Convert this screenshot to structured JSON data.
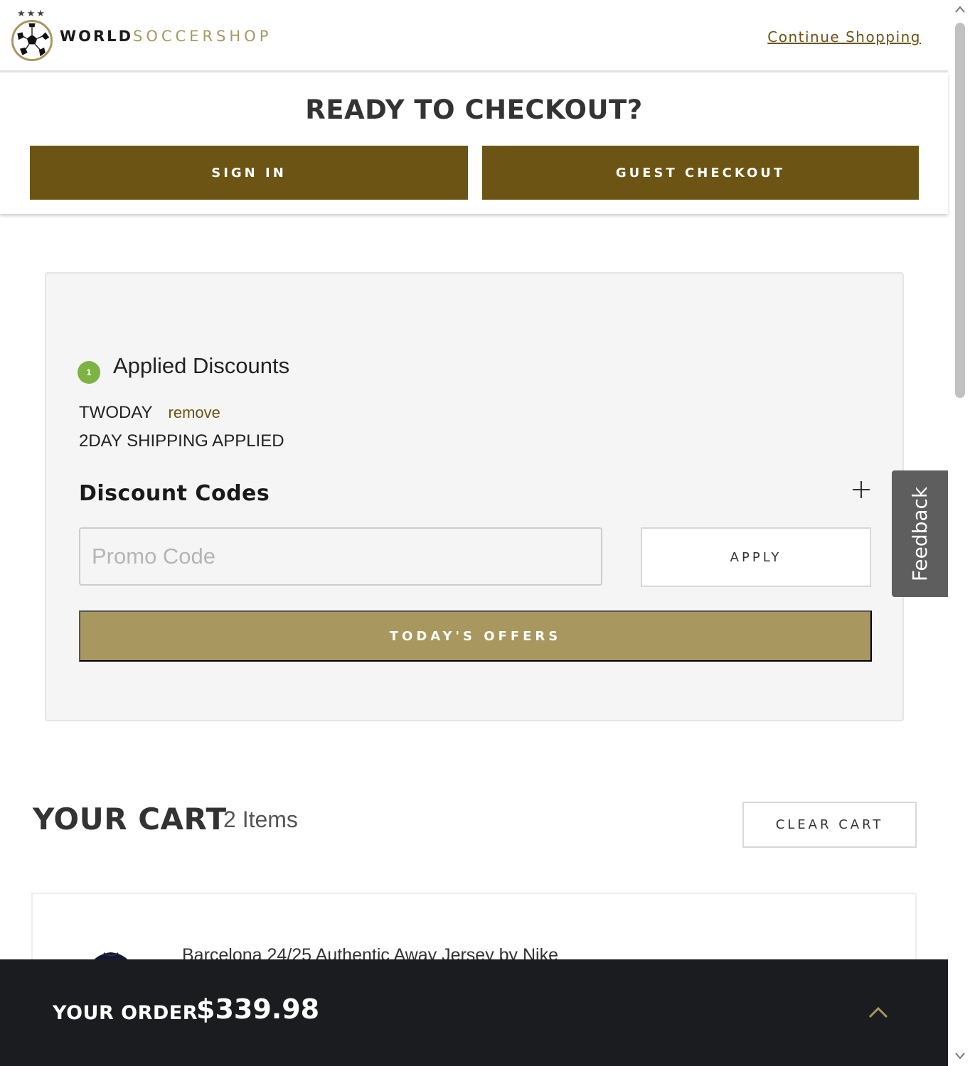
{
  "header": {
    "brand_word1": "WORLD",
    "brand_word2": "SOCCERSHOP",
    "stars": "★★★",
    "continue_link": "Continue Shopping"
  },
  "checkout": {
    "title": "READY TO CHECKOUT?",
    "sign_in_label": "SIGN IN",
    "guest_label": "GUEST CHECKOUT"
  },
  "discounts": {
    "applied_count": "1",
    "applied_title": "Applied Discounts",
    "applied": [
      {
        "code": "TWODAY",
        "remove_label": "remove",
        "description": "2DAY SHIPPING APPLIED"
      }
    ],
    "codes_title": "Discount Codes",
    "promo_placeholder": "Promo Code",
    "apply_label": "APPLY",
    "offers_label": "TODAY'S OFFERS"
  },
  "feedback_label": "Feedback",
  "cart": {
    "title": "YOUR CART",
    "count_label": "2 Items",
    "clear_label": "CLEAR CART",
    "items": [
      {
        "name": "Barcelona 24/25 Authentic Away Jersey by Nike"
      }
    ]
  },
  "order": {
    "label": "YOUR ORDER",
    "total": "$339.98"
  },
  "icons": {
    "plus": "plus-icon",
    "chevron": "chevron-up-icon",
    "ball": "soccer-ball-icon"
  },
  "colors": {
    "gold_dark": "#6b5414",
    "gold_light": "#a8975f",
    "badge_green": "#7cb342",
    "order_bar": "#1b1c1f"
  }
}
